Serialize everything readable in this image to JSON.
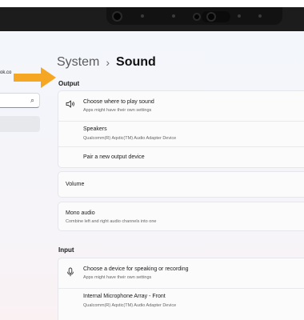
{
  "sidebar": {
    "account_email": "ok.co",
    "search_icon": "⌕"
  },
  "header": {
    "breadcrumb_parent": "System",
    "breadcrumb_separator": "›",
    "breadcrumb_current": "Sound"
  },
  "annotation": {
    "arrow_color": "#f5a623"
  },
  "output": {
    "section_label": "Output",
    "choose": {
      "title": "Choose where to play sound",
      "subtitle": "Apps might have their own settings",
      "icon": "speaker-icon"
    },
    "device": {
      "title": "Speakers",
      "subtitle": "Qualcomm(R) Aqstic(TM) Audio Adapter Device"
    },
    "pair_label": "Pair a new output device",
    "volume_label": "Volume",
    "mono": {
      "title": "Mono audio",
      "subtitle": "Combine left and right audio channels into one"
    }
  },
  "input": {
    "section_label": "Input",
    "choose": {
      "title": "Choose a device for speaking or recording",
      "subtitle": "Apps might have their own settings",
      "icon": "microphone-icon"
    },
    "device": {
      "title": "Internal Microphone Array - Front",
      "subtitle": "Qualcomm(R) Aqstic(TM) Audio Adapter Device"
    }
  }
}
